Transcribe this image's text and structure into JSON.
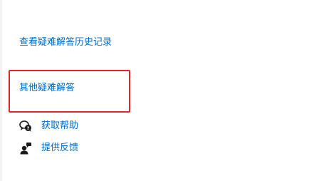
{
  "troubleshoot": {
    "history_link": "查看疑难解答历史记录",
    "other_link": "其他疑难解答"
  },
  "actions": {
    "help_label": "获取帮助",
    "feedback_label": "提供反馈"
  },
  "colors": {
    "link": "#0067c0",
    "highlight_border": "#e5252a",
    "icon": "#1a1a1a"
  },
  "icons": {
    "help": "get-help-icon",
    "feedback": "feedback-icon"
  }
}
